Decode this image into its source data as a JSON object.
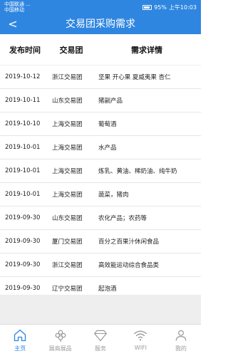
{
  "status": {
    "carrier_line1": "中国联通 ...",
    "carrier_line2": "中国移动",
    "battery": "95%",
    "time": "上午10:03"
  },
  "nav": {
    "back_glyph": "<",
    "title": "交易团采购需求"
  },
  "table": {
    "headers": {
      "date": "发布时间",
      "group": "交易团",
      "detail": "需求详情"
    },
    "rows": [
      {
        "date": "2019-10-12",
        "group": "浙江交易团",
        "detail": "坚果 开心果 夏威夷果 杏仁"
      },
      {
        "date": "2019-10-11",
        "group": "山东交易团",
        "detail": "猪副产品"
      },
      {
        "date": "2019-10-10",
        "group": "上海交易团",
        "detail": "葡萄酒"
      },
      {
        "date": "2019-10-01",
        "group": "上海交易团",
        "detail": "水产品"
      },
      {
        "date": "2019-10-01",
        "group": "上海交易团",
        "detail": "炼乳、黄油、稀奶油、纯牛奶"
      },
      {
        "date": "2019-10-01",
        "group": "上海交易团",
        "detail": "蔬菜，猪肉"
      },
      {
        "date": "2019-09-30",
        "group": "山东交易团",
        "detail": "农化产品；农药等"
      },
      {
        "date": "2019-09-30",
        "group": "厦门交易团",
        "detail": "百分之百果汁休闲食品"
      },
      {
        "date": "2019-09-30",
        "group": "浙江交易团",
        "detail": "高效能运动综合食品类"
      },
      {
        "date": "2019-09-30",
        "group": "辽宁交易团",
        "detail": "起泡酒"
      }
    ]
  },
  "tabs": [
    {
      "label": "主页",
      "icon": "home-icon",
      "active": true
    },
    {
      "label": "展商展品",
      "icon": "exhibitor-icon",
      "active": false
    },
    {
      "label": "服务",
      "icon": "diamond-icon",
      "active": false
    },
    {
      "label": "WIFI",
      "icon": "wifi-icon",
      "active": false
    },
    {
      "label": "我的",
      "icon": "user-icon",
      "active": false
    }
  ],
  "colors": {
    "primary": "#2f86e0",
    "inactive": "#9a9a9a",
    "divider": "#e6e6e6"
  }
}
